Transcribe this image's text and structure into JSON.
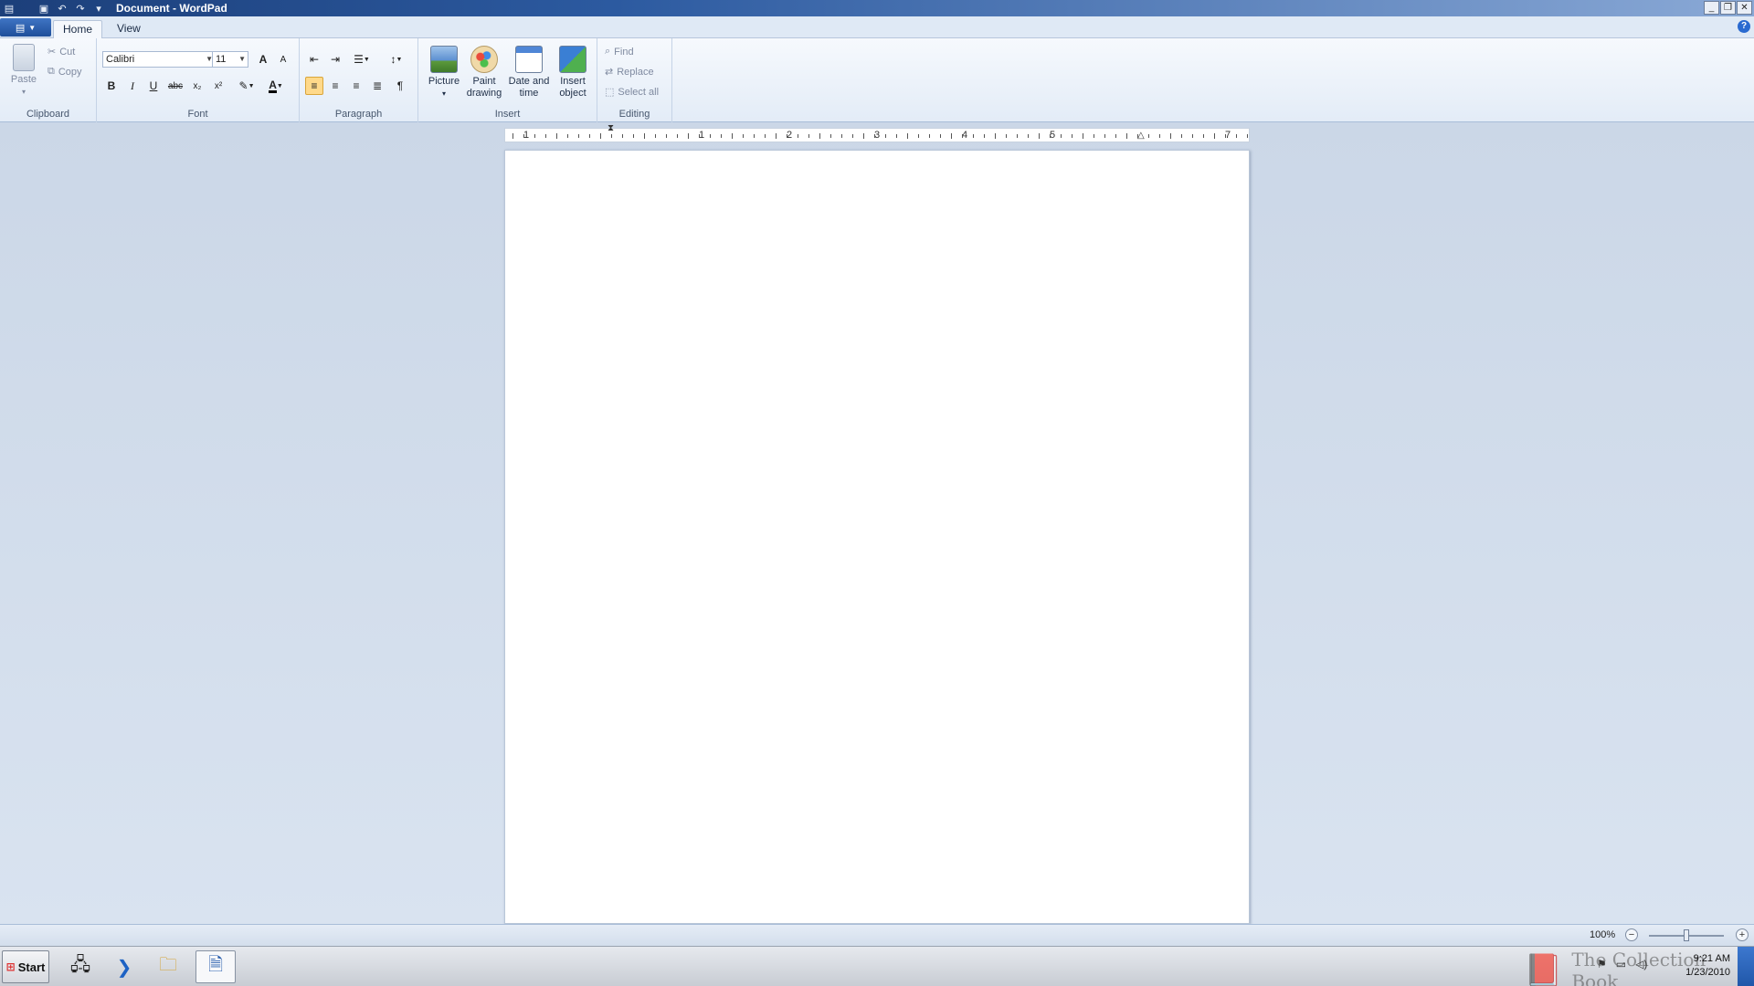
{
  "window": {
    "title": "Document - WordPad",
    "controls": {
      "minimize": "_",
      "restore": "❐",
      "close": "✕"
    }
  },
  "quick_access": [
    "save-icon",
    "undo-icon",
    "redo-icon",
    "customize-icon"
  ],
  "tabs": [
    {
      "label": "Home",
      "active": true
    },
    {
      "label": "View",
      "active": false
    }
  ],
  "help": "?",
  "ribbon": {
    "clipboard": {
      "label": "Clipboard",
      "paste": "Paste",
      "cut": "Cut",
      "copy": "Copy"
    },
    "font": {
      "label": "Font",
      "family": "Calibri",
      "size": "11",
      "bold": "B",
      "italic": "I",
      "underline": "U",
      "strike": "abc",
      "subscript": "x₂",
      "superscript": "x²",
      "grow": "A",
      "shrink": "A",
      "font_color_letter": "A"
    },
    "paragraph": {
      "label": "Paragraph"
    },
    "insert": {
      "label": "Insert",
      "picture": "Picture",
      "paint": "Paint drawing",
      "datetime": "Date and time",
      "object": "Insert object"
    },
    "editing": {
      "label": "Editing",
      "find": "Find",
      "replace": "Replace",
      "select_all": "Select all"
    }
  },
  "ruler": {
    "numbers": [
      "1",
      "1",
      "2",
      "3",
      "4",
      "5",
      "7"
    ]
  },
  "status": {
    "zoom": "100%",
    "zoom_out": "−",
    "zoom_in": "+",
    "zoom_level": 0.5
  },
  "taskbar": {
    "start": "Start",
    "watermark": "The Collection Book",
    "time": "9:21 AM",
    "date": "1/23/2010"
  },
  "colors": {
    "title_bar": "#2c5aa0",
    "ribbon_bg": "#e3ecf7",
    "workspace": "#cfd9e8",
    "selected_align": "#ffd98a"
  }
}
